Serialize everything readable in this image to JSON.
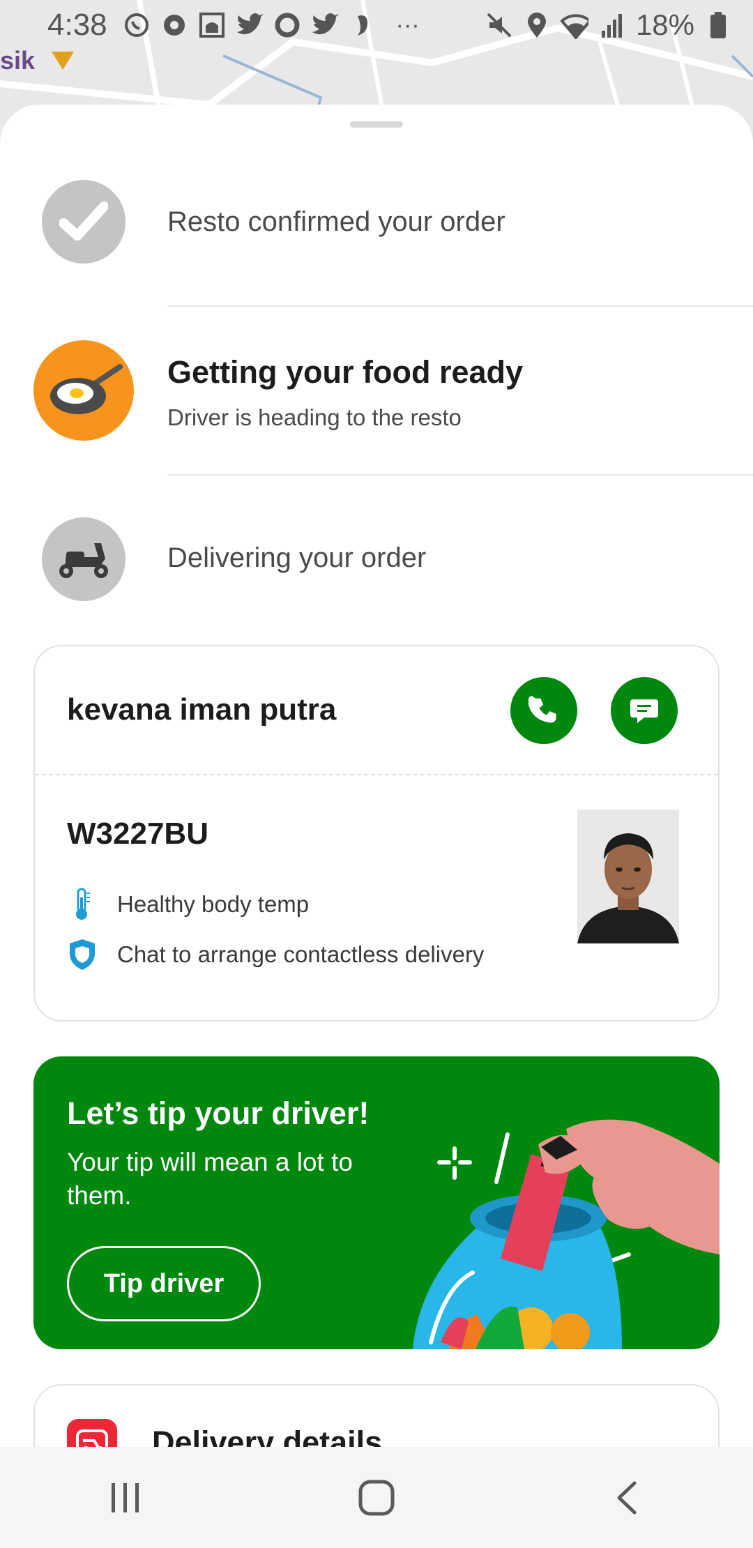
{
  "status_bar": {
    "time": "4:38",
    "battery": "18%",
    "overflow": "···"
  },
  "map": {
    "partial_label": "sik"
  },
  "steps": [
    {
      "title": "Resto confirmed your order",
      "state": "done",
      "icon": "check-icon"
    },
    {
      "title": "Getting your food ready",
      "subtitle": "Driver is heading to the resto",
      "state": "active",
      "icon": "frying-pan-icon"
    },
    {
      "title": "Delivering your order",
      "state": "pending",
      "icon": "scooter-icon"
    }
  ],
  "driver": {
    "name": "kevana iman putra",
    "plate": "W3227BU",
    "info": [
      {
        "icon": "thermometer-icon",
        "text": "Healthy body temp"
      },
      {
        "icon": "shield-icon",
        "text": "Chat to arrange contactless delivery"
      }
    ],
    "actions": [
      {
        "icon": "phone-icon",
        "name": "call-driver-button"
      },
      {
        "icon": "chat-icon",
        "name": "chat-driver-button"
      }
    ]
  },
  "tip": {
    "title": "Let’s tip your driver!",
    "subtitle": "Your tip will mean a lot to them.",
    "button_label": "Tip driver"
  },
  "delivery_details": {
    "title": "Delivery details",
    "icon": "delivery-icon"
  },
  "nav": [
    "recent-apps-icon",
    "home-icon",
    "back-icon"
  ],
  "colors": {
    "brand_green": "#00880e",
    "active_orange": "#f7941d",
    "inactive_grey": "#c4c4c4",
    "accent_blue": "#1e9bd7",
    "accent_red": "#ee2737"
  }
}
